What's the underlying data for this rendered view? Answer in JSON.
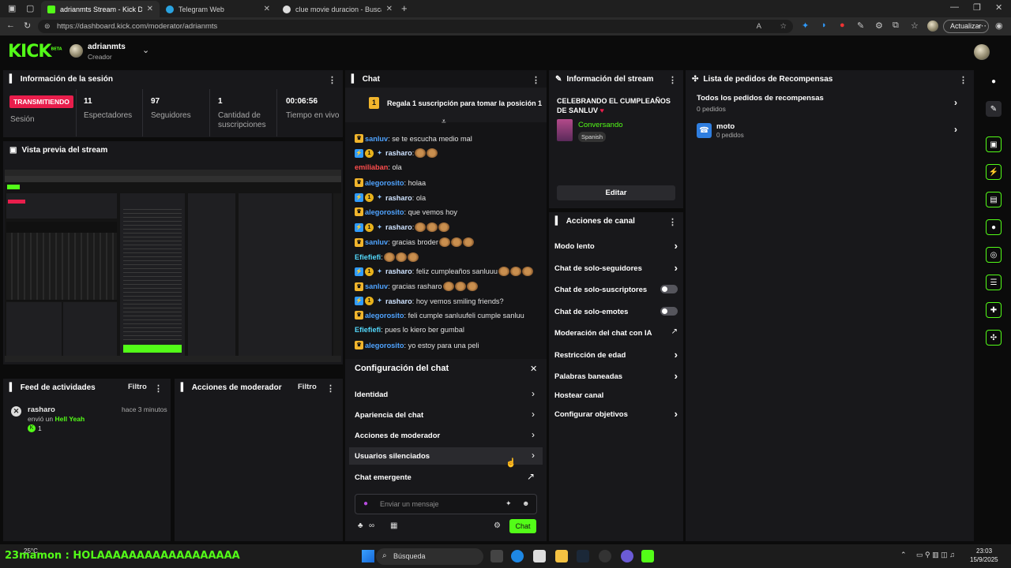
{
  "browser": {
    "tabs": [
      {
        "title": "adrianmts Stream - Kick Dashbo",
        "active": true
      },
      {
        "title": "Telegram Web",
        "active": false
      },
      {
        "title": "clue movie duracion - Buscar con",
        "active": false
      }
    ],
    "url": "https://dashboard.kick.com/moderator/adrianmts",
    "update_label": "Actualizar"
  },
  "header": {
    "logo": "KICK",
    "logo_tag": "BETA",
    "username": "adrianmts",
    "role": "Creador"
  },
  "session": {
    "title": "Información de la sesión",
    "status": "TRANSMITIENDO",
    "session_label": "Sesión",
    "stats": [
      {
        "value": "11",
        "label": "Espectadores"
      },
      {
        "value": "97",
        "label": "Seguidores"
      },
      {
        "value": "1",
        "label": "Cantidad de suscripciones"
      },
      {
        "value": "00:06:56",
        "label": "Tiempo en vivo"
      }
    ]
  },
  "preview": {
    "title": "Vista previa del stream"
  },
  "activity": {
    "title": "Feed de actividades",
    "filter": "Filtro",
    "item": {
      "user": "rasharo",
      "time": "hace 3 minutos",
      "action": "envió un",
      "item": "Hell Yeah",
      "count": "1"
    }
  },
  "modactions": {
    "title": "Acciones de moderador",
    "filter": "Filtro"
  },
  "chat": {
    "title": "Chat",
    "pinned": "Regala 1 suscripción para tomar la posición 1",
    "pinned_badge": "1",
    "messages": [
      {
        "user": "sanluv",
        "color": "#4fa3ff",
        "text": ": se te escucha medio mal"
      },
      {
        "user": "rasharo",
        "color": "#cfe3ff",
        "text": ":"
      },
      {
        "user": "emiliaban",
        "color": "#ff4d4d",
        "text": ": ola"
      },
      {
        "user": "alegorosito",
        "color": "#4fa3ff",
        "text": ": holaa"
      },
      {
        "user": "rasharo",
        "color": "#cfe3ff",
        "text": ": ola"
      },
      {
        "user": "alegorosito",
        "color": "#4fa3ff",
        "text": ": que vemos hoy"
      },
      {
        "user": "rasharo",
        "color": "#cfe3ff",
        "text": ":"
      },
      {
        "user": "sanluv",
        "color": "#4fa3ff",
        "text": ": gracias broder"
      },
      {
        "user": "Efiefiefi",
        "color": "#53d8fb",
        "text": ":"
      },
      {
        "user": "rasharo",
        "color": "#cfe3ff",
        "text": ": feliz cumpleaños sanluuu"
      },
      {
        "user": "sanluv",
        "color": "#4fa3ff",
        "text": ": gracias rasharo"
      },
      {
        "user": "rasharo",
        "color": "#cfe3ff",
        "text": ": hoy vemos smiling friends?"
      },
      {
        "user": "alegorosito",
        "color": "#4fa3ff",
        "text": ": feli cumple sanluufeli cumple sanluu"
      },
      {
        "user": "Efiefiefi",
        "color": "#53d8fb",
        "text": ": pues lo kiero ber gumbal"
      },
      {
        "user": "alegorosito",
        "color": "#4fa3ff",
        "text": ": yo estoy para una peli"
      }
    ],
    "settings_title": "Configuración del chat",
    "settings_items": [
      "Identidad",
      "Apariencia del chat",
      "Acciones de moderador",
      "Usuarios silenciados",
      "Chat emergente"
    ],
    "input_placeholder": "Enviar un mensaje",
    "send_label": "Chat"
  },
  "stream_info": {
    "title": "Información del stream",
    "stream_title": "CELEBRANDO EL CUMPLEAÑOS DE SANLUV",
    "category": "Conversando",
    "language": "Spanish",
    "edit": "Editar"
  },
  "channel_actions": {
    "title": "Acciones de canal",
    "items": [
      {
        "label": "Modo lento",
        "kind": "chevron"
      },
      {
        "label": "Chat de solo-seguidores",
        "kind": "chevron"
      },
      {
        "label": "Chat de solo-suscriptores",
        "kind": "toggle"
      },
      {
        "label": "Chat de solo-emotes",
        "kind": "toggle"
      },
      {
        "label": "Moderación del chat con IA",
        "kind": "external"
      },
      {
        "label": "Restricción de edad",
        "kind": "chevron"
      },
      {
        "label": "Palabras baneadas",
        "kind": "chevron"
      },
      {
        "label": "Hostear canal",
        "kind": "none"
      },
      {
        "label": "Configurar objetivos",
        "kind": "chevron"
      }
    ]
  },
  "rewards": {
    "title": "Lista de pedidos de Recompensas",
    "all_title": "Todos los pedidos de recompensas",
    "all_count": "0 pedidos",
    "item_name": "moto",
    "item_count": "0 pedidos"
  },
  "overlay": {
    "weather": "25°C",
    "text": "23mamon : HOLAAAAAAAAAAAAAAAAAA"
  },
  "taskbar": {
    "search": "Búsqueda",
    "time": "23:03",
    "date": "15/9/2025"
  },
  "colors": {
    "accent": "#53fc18",
    "live": "#e91e4c",
    "panel": "#18181b"
  }
}
